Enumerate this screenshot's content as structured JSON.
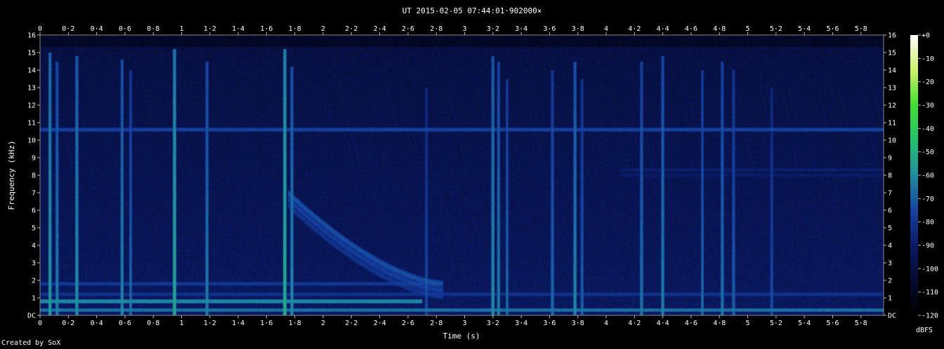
{
  "chart_data": {
    "type": "heatmap",
    "title": "UT 2015-02-05 07:44:01·902000×",
    "xlabel": "Time (s)",
    "ylabel": "Frequency (kHz)",
    "xlim": [
      0,
      5.96
    ],
    "ylim": [
      0,
      16
    ],
    "x_ticks": [
      "0",
      "0·2",
      "0·4",
      "0·6",
      "0·8",
      "1",
      "1·2",
      "1·4",
      "1·6",
      "1·8",
      "2",
      "2·2",
      "2·4",
      "2·6",
      "2·8",
      "3",
      "3·2",
      "3·4",
      "3·6",
      "3·8",
      "4",
      "4·2",
      "4·4",
      "4·6",
      "4·8",
      "5",
      "5·2",
      "5·4",
      "5·6",
      "5·8"
    ],
    "x_tick_values": [
      0,
      0.2,
      0.4,
      0.6,
      0.8,
      1,
      1.2,
      1.4,
      1.6,
      1.8,
      2,
      2.2,
      2.4,
      2.6,
      2.8,
      3,
      3.2,
      3.4,
      3.6,
      3.8,
      4,
      4.2,
      4.4,
      4.6,
      4.8,
      5,
      5.2,
      5.4,
      5.6,
      5.8
    ],
    "y_ticks": [
      "DC",
      "1",
      "2",
      "3",
      "4",
      "5",
      "6",
      "7",
      "8",
      "9",
      "10",
      "11",
      "12",
      "13",
      "14",
      "15",
      "16"
    ],
    "y_tick_values": [
      0,
      1,
      2,
      3,
      4,
      5,
      6,
      7,
      8,
      9,
      10,
      11,
      12,
      13,
      14,
      15,
      16
    ],
    "colorbar": {
      "label": "dBFS",
      "ticks": [
        "+0",
        "-10",
        "-20",
        "-30",
        "-40",
        "-50",
        "-60",
        "-70",
        "-80",
        "-90",
        "-100",
        "-110",
        "-120"
      ],
      "tick_values": [
        0,
        -10,
        -20,
        -30,
        -40,
        -50,
        -60,
        -70,
        -80,
        -90,
        -100,
        -110,
        -120
      ],
      "range": [
        -120,
        0
      ]
    },
    "features": {
      "background_dbfs": -100,
      "tones": [
        {
          "freq": 10.6,
          "t_start": 0.0,
          "t_end": 5.96,
          "dbfs": -75
        },
        {
          "freq": 8.3,
          "t_start": 4.1,
          "t_end": 5.96,
          "dbfs": -88
        },
        {
          "freq": 8.0,
          "t_start": 4.1,
          "t_end": 5.96,
          "dbfs": -90
        },
        {
          "freq": 0.8,
          "t_start": 0.0,
          "t_end": 2.7,
          "dbfs": -60
        },
        {
          "freq": 0.3,
          "t_start": 0.0,
          "t_end": 5.96,
          "dbfs": -65
        },
        {
          "freq": 1.8,
          "t_start": 0.0,
          "t_end": 2.8,
          "dbfs": -78
        },
        {
          "freq": 1.2,
          "t_start": 0.0,
          "t_end": 5.96,
          "dbfs": -80
        }
      ],
      "clicks": [
        {
          "t": 0.07,
          "f_max": 15.0,
          "dbfs": -55
        },
        {
          "t": 0.12,
          "f_max": 14.5,
          "dbfs": -62
        },
        {
          "t": 0.26,
          "f_max": 14.8,
          "dbfs": -58
        },
        {
          "t": 0.58,
          "f_max": 14.6,
          "dbfs": -60
        },
        {
          "t": 0.64,
          "f_max": 14.0,
          "dbfs": -66
        },
        {
          "t": 0.95,
          "f_max": 15.2,
          "dbfs": -52
        },
        {
          "t": 1.18,
          "f_max": 14.5,
          "dbfs": -62
        },
        {
          "t": 1.73,
          "f_max": 15.2,
          "dbfs": -50
        },
        {
          "t": 1.78,
          "f_max": 14.2,
          "dbfs": -60
        },
        {
          "t": 2.73,
          "f_max": 13.0,
          "dbfs": -72
        },
        {
          "t": 3.2,
          "f_max": 14.8,
          "dbfs": -58
        },
        {
          "t": 3.24,
          "f_max": 14.5,
          "dbfs": -62
        },
        {
          "t": 3.3,
          "f_max": 13.5,
          "dbfs": -66
        },
        {
          "t": 3.62,
          "f_max": 14.0,
          "dbfs": -66
        },
        {
          "t": 3.78,
          "f_max": 14.5,
          "dbfs": -60
        },
        {
          "t": 3.83,
          "f_max": 13.5,
          "dbfs": -68
        },
        {
          "t": 4.25,
          "f_max": 14.5,
          "dbfs": -64
        },
        {
          "t": 4.4,
          "f_max": 14.8,
          "dbfs": -62
        },
        {
          "t": 4.68,
          "f_max": 14.0,
          "dbfs": -66
        },
        {
          "t": 4.82,
          "f_max": 14.5,
          "dbfs": -64
        },
        {
          "t": 4.9,
          "f_max": 14.0,
          "dbfs": -68
        },
        {
          "t": 5.17,
          "f_max": 13.0,
          "dbfs": -72
        }
      ],
      "sweep": {
        "t_start": 1.75,
        "t_end": 2.85,
        "f_start": 7.0,
        "f_end": 1.8,
        "dbfs": -72
      }
    }
  },
  "credit": "Created by SoX"
}
